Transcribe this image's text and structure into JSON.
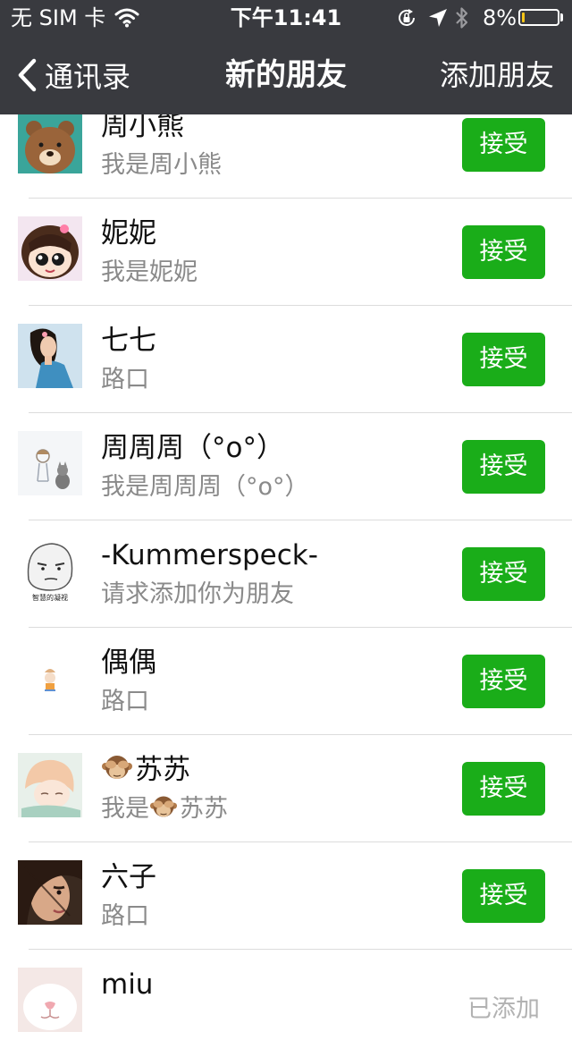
{
  "status_bar": {
    "carrier": "无 SIM 卡",
    "time": "下午11:41",
    "battery_percent": "8%",
    "battery_level": 0.08,
    "battery_color": "#f5c518",
    "icons": [
      "wifi-icon",
      "orientation-lock-icon",
      "location-arrow-icon",
      "bluetooth-icon",
      "battery-icon"
    ]
  },
  "nav": {
    "back_label": "通讯录",
    "title": "新的朋友",
    "action_label": "添加朋友",
    "background": "#393a3f"
  },
  "accent_color": "#1aad19",
  "requests": [
    {
      "name": "周小熊",
      "message": "我是周小熊",
      "avatar": "brown-bear-avatar",
      "action": "接受"
    },
    {
      "name": "妮妮",
      "message": "我是妮妮",
      "avatar": "cartoon-girl-avatar",
      "action": "接受"
    },
    {
      "name": "七七",
      "message": "路口",
      "avatar": "woman-photo-avatar",
      "action": "接受"
    },
    {
      "name": "周周周（°o°）",
      "message": "我是周周周（°o°）",
      "avatar": "sketch-with-cat-avatar",
      "action": "接受"
    },
    {
      "name": "-Kummerspeck-",
      "message": "请求添加你为朋友",
      "avatar": "meme-face-avatar",
      "avatar_caption": "智慧的凝视",
      "action": "接受"
    },
    {
      "name": "偶偶",
      "message": "路口",
      "avatar": "small-doodle-avatar",
      "action": "接受"
    },
    {
      "name": "苏苏",
      "name_prefix_icon": "see-no-evil-monkey-emoji",
      "message_prefix": "我是",
      "message": "苏苏",
      "avatar": "anime-boy-avatar",
      "action": "接受"
    },
    {
      "name": "六子",
      "message": "路口",
      "avatar": "girl-face-photo-avatar",
      "action": "接受"
    },
    {
      "name": "miu",
      "message": "",
      "avatar": "cat-closeup-avatar",
      "status": "已添加"
    }
  ]
}
